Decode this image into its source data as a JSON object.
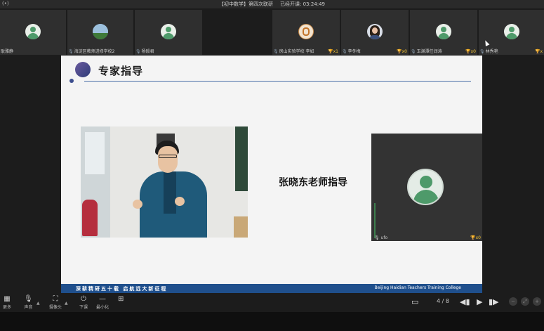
{
  "window": {
    "app_icon": "(•)",
    "title": "【初中数学】第四次联研",
    "elapsed_label": "已经开课: 03:24:49"
  },
  "participants": [
    {
      "name": "耿雅静",
      "avatar": "default",
      "badge": ""
    },
    {
      "name": "海淀区教师进修学校2",
      "avatar": "mountain-photo",
      "badge": ""
    },
    {
      "name": "杨毅君",
      "avatar": "default",
      "badge": ""
    },
    {
      "name": "房山实验学校 李如",
      "avatar": "logo",
      "badge": "x1"
    },
    {
      "name": "李冬梅",
      "avatar": "person-photo",
      "badge": "x0"
    },
    {
      "name": "玉渊潭任润涛",
      "avatar": "default",
      "badge": "x0"
    },
    {
      "name": "林秀艳",
      "avatar": "default",
      "badge": "x"
    }
  ],
  "slide": {
    "title": "专家指导",
    "caption": "张晓东老师指导",
    "camera": {
      "name": "ufo",
      "badge": "x0"
    },
    "footer_left": "深耕精研五十载 启航远大新征程",
    "footer_right": "Beijing Haidian Teachers Training College"
  },
  "toolbar": {
    "more": "更多",
    "audio": "声音",
    "camera": "摄像头",
    "leave": "下课",
    "minimize": "最小化",
    "page_indicator": "4 / 8"
  },
  "icons": {
    "more": "grid-icon",
    "audio": "microphone-icon",
    "camera": "camera-icon",
    "leave": "power-icon",
    "minimize": "minimize-icon",
    "layout": "layout-icon",
    "slides": "slides-icon",
    "prev": "prev-slide-icon",
    "play": "play-icon",
    "next": "next-slide-icon"
  },
  "colors": {
    "slide_accent": "#1f4f8c",
    "badge": "#f2c233",
    "avatar_green": "#4e9a6a"
  }
}
